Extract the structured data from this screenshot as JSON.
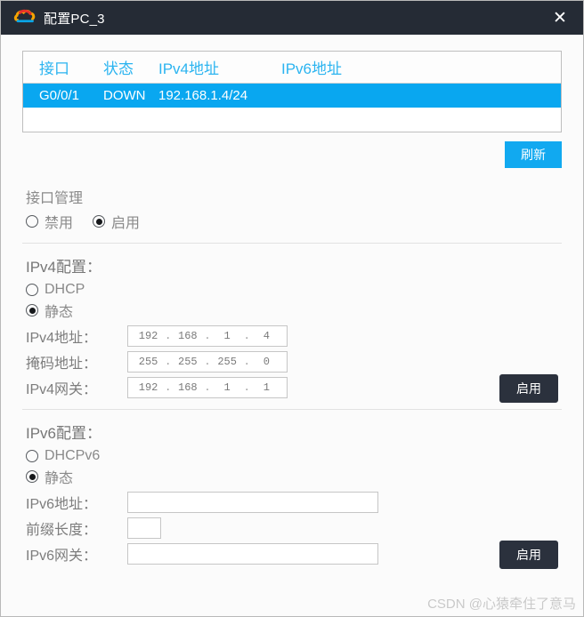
{
  "window": {
    "title": "配置PC_3",
    "icon": "cloud-icon",
    "close_label": "✕"
  },
  "interface_table": {
    "columns": [
      "接口",
      "状态",
      "IPv4地址",
      "IPv6地址"
    ],
    "rows": [
      {
        "interface": "G0/0/1",
        "status": "DOWN",
        "ipv4": "192.168.1.4/24",
        "ipv6": "",
        "selected": true
      }
    ],
    "refresh_label": "刷新"
  },
  "interface_mgmt": {
    "title": "接口管理",
    "options": [
      {
        "label": "禁用",
        "selected": false
      },
      {
        "label": "启用",
        "selected": true
      }
    ]
  },
  "ipv4": {
    "title": "IPv4配置：",
    "modes": [
      {
        "label": "DHCP",
        "selected": false
      },
      {
        "label": "静态",
        "selected": true
      }
    ],
    "address": {
      "label": "IPv4地址：",
      "octets": [
        "192",
        "168",
        "1",
        "4"
      ]
    },
    "mask": {
      "label": "掩码地址：",
      "octets": [
        "255",
        "255",
        "255",
        "0"
      ]
    },
    "gateway": {
      "label": "IPv4网关：",
      "octets": [
        "192",
        "168",
        "1",
        "1"
      ]
    },
    "apply_label": "启用"
  },
  "ipv6": {
    "title": "IPv6配置：",
    "modes": [
      {
        "label": "DHCPv6",
        "selected": false
      },
      {
        "label": "静态",
        "selected": true
      }
    ],
    "address": {
      "label": "IPv6地址：",
      "value": ""
    },
    "prefix": {
      "label": "前缀长度：",
      "value": ""
    },
    "gateway": {
      "label": "IPv6网关：",
      "value": ""
    },
    "apply_label": "启用"
  },
  "watermark": "CSDN @心猿牵住了意马",
  "colors": {
    "titlebar_bg": "#252b35",
    "accent_blue": "#11a9f0",
    "row_selected_bg": "#09a7f0",
    "dark_button": "#2b313d",
    "label_gray": "#7d7d7d"
  }
}
